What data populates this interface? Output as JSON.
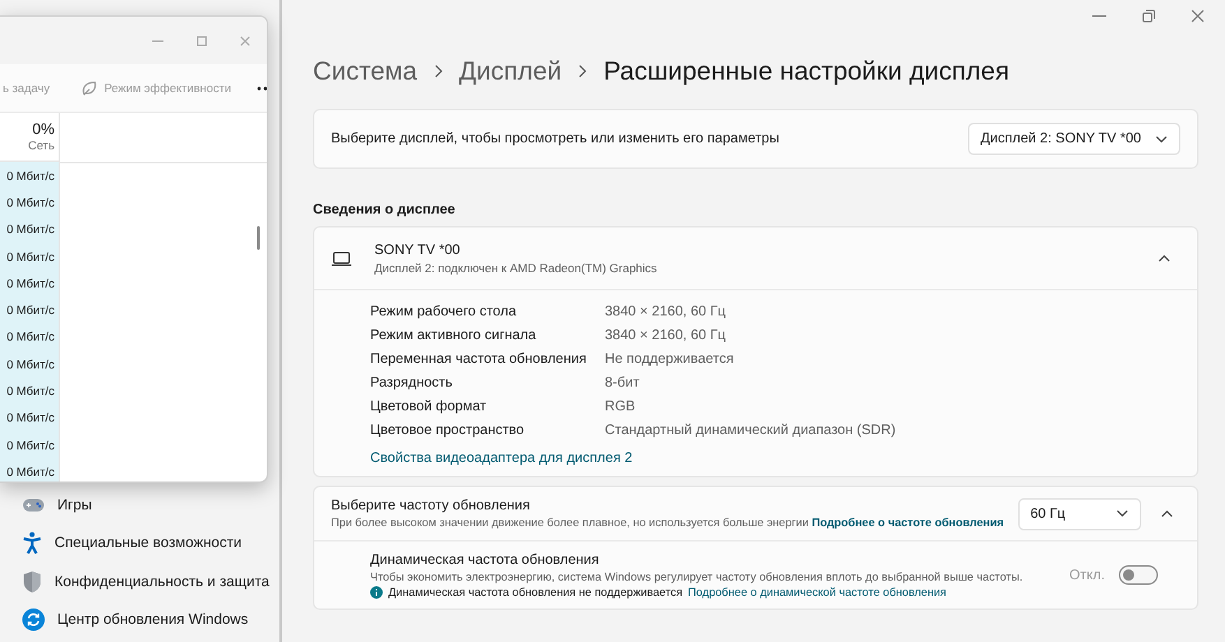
{
  "task_manager": {
    "toolbar": [
      {
        "kind": "text",
        "label": "ь задачу"
      },
      {
        "kind": "leaf",
        "label": "Режим эффективности"
      },
      {
        "kind": "more"
      }
    ],
    "column": {
      "value": "0%",
      "label": "Сеть"
    },
    "rows": [
      "0 Мбит/с",
      "0 Мбит/с",
      "0 Мбит/с",
      "0 Мбит/с",
      "0 Мбит/с",
      "0 Мбит/с",
      "0 Мбит/с",
      "0 Мбит/с",
      "0 Мбит/с",
      "0 Мбит/с",
      "0 Мбит/с",
      "0 Мбит/с"
    ]
  },
  "sidebar": {
    "items": [
      {
        "label": "Игры"
      },
      {
        "label": "Специальные возможности"
      },
      {
        "label": "Конфиденциальность и защита"
      },
      {
        "label": "Центр обновления Windows"
      }
    ]
  },
  "breadcrumb": [
    "Система",
    "Дисплей",
    "Расширенные настройки дисплея"
  ],
  "display_select": {
    "label": "Выберите дисплей, чтобы просмотреть или изменить его параметры",
    "value": "Дисплей 2: SONY TV  *00"
  },
  "section_title": "Сведения о дисплее",
  "display_info": {
    "name": "SONY TV  *00",
    "subtitle": "Дисплей 2: подключен к AMD Radeon(TM) Graphics",
    "expanded": true,
    "rows": [
      {
        "label": "Режим рабочего стола",
        "value": "3840 × 2160, 60 Гц"
      },
      {
        "label": "Режим активного сигнала",
        "value": "3840 × 2160, 60 Гц"
      },
      {
        "label": "Переменная частота обновления",
        "value": "Не поддерживается"
      },
      {
        "label": "Разрядность",
        "value": "8-бит"
      },
      {
        "label": "Цветовой формат",
        "value": "RGB"
      },
      {
        "label": "Цветовое пространство",
        "value": "Стандартный динамический диапазон (SDR)"
      }
    ],
    "link": "Свойства видеоадаптера для дисплея 2"
  },
  "refresh_rate": {
    "title": "Выберите частоту обновления",
    "description": "При более высоком значении движение более плавное, но используется больше энергии",
    "link": "Подробнее о частоте обновления",
    "value": "60 Гц",
    "expanded": true,
    "dynamic": {
      "title": "Динамическая частота обновления",
      "description": "Чтобы экономить электроэнергию, система Windows регулирует частоту обновления вплоть до выбранной выше частоты.",
      "state_label": "Откл.",
      "on": false,
      "notice": "Динамическая частота обновления не поддерживается",
      "notice_link": "Подробнее о динамической частоте обновления"
    }
  }
}
